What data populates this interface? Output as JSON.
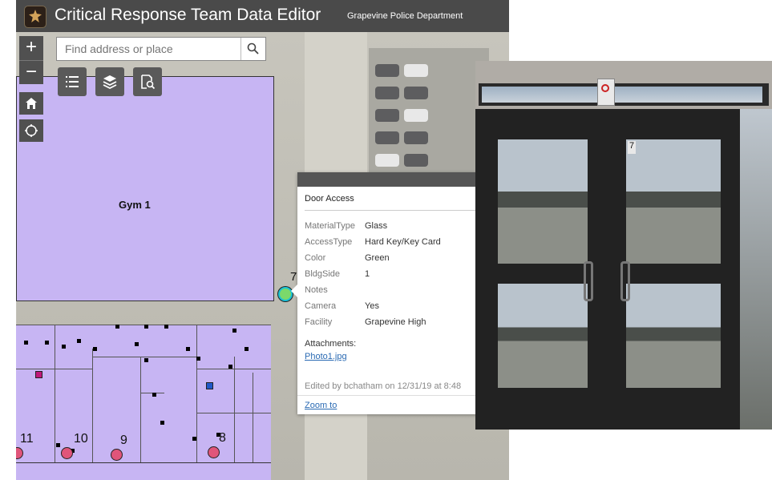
{
  "header": {
    "title": "Critical Response Team Data Editor",
    "org": "Grapevine Police Department",
    "logo_icon": "police-badge-icon"
  },
  "search": {
    "placeholder": "Find address or place",
    "icon": "search-icon"
  },
  "widgets": {
    "zoom_in": "+",
    "zoom_out": "−",
    "home_icon": "home-icon",
    "locate_icon": "locate-icon",
    "tools": [
      "legend-icon",
      "layers-icon",
      "query-icon"
    ]
  },
  "map": {
    "gym_label": "Gym 1",
    "selected_door_number": "7",
    "door_numbers": [
      "11",
      "10",
      "9",
      "8"
    ]
  },
  "popup": {
    "title": "Door Access",
    "attributes": [
      {
        "key": "MaterialType",
        "value": "Glass"
      },
      {
        "key": "AccessType",
        "value": "Hard Key/Key Card"
      },
      {
        "key": "Color",
        "value": "Green"
      },
      {
        "key": "BldgSide",
        "value": "1"
      },
      {
        "key": "Notes",
        "value": ""
      },
      {
        "key": "Camera",
        "value": "Yes"
      },
      {
        "key": "Facility",
        "value": "Grapevine High"
      }
    ],
    "attachments_label": "Attachments:",
    "attachment_file": "Photo1.jpg",
    "edited_text": "Edited by bchatham on 12/31/19 at 8:48",
    "zoom_to": "Zoom to"
  },
  "photo": {
    "door_number": "7"
  }
}
